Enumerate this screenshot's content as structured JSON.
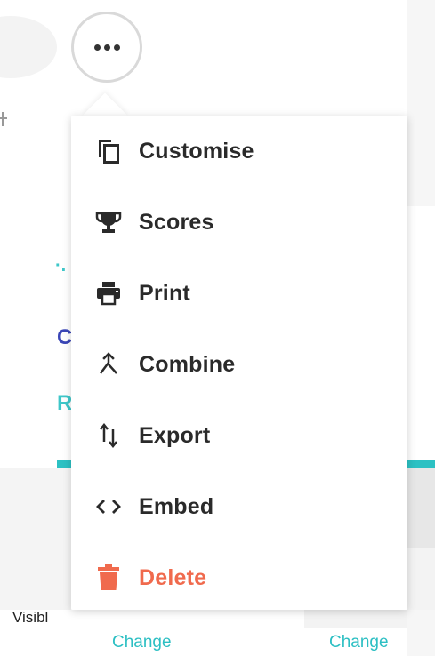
{
  "menu": {
    "items": [
      {
        "label": "Customise",
        "icon": "copy-icon"
      },
      {
        "label": "Scores",
        "icon": "trophy-icon"
      },
      {
        "label": "Print",
        "icon": "printer-icon"
      },
      {
        "label": "Combine",
        "icon": "merge-icon"
      },
      {
        "label": "Export",
        "icon": "swap-vertical-icon"
      },
      {
        "label": "Embed",
        "icon": "code-icon"
      },
      {
        "label": "Delete",
        "icon": "trash-icon"
      }
    ]
  },
  "background": {
    "visible_label": "Visibl",
    "change_label_1": "Change",
    "change_label_2": "Change",
    "fragment_c": "C",
    "fragment_r": "R",
    "fragment_dot": "·."
  },
  "colors": {
    "accent_teal": "#2cc1c3",
    "delete_red": "#f06a4d",
    "text_dark": "#2a2a2a",
    "brand_blue": "#3a46b7"
  }
}
